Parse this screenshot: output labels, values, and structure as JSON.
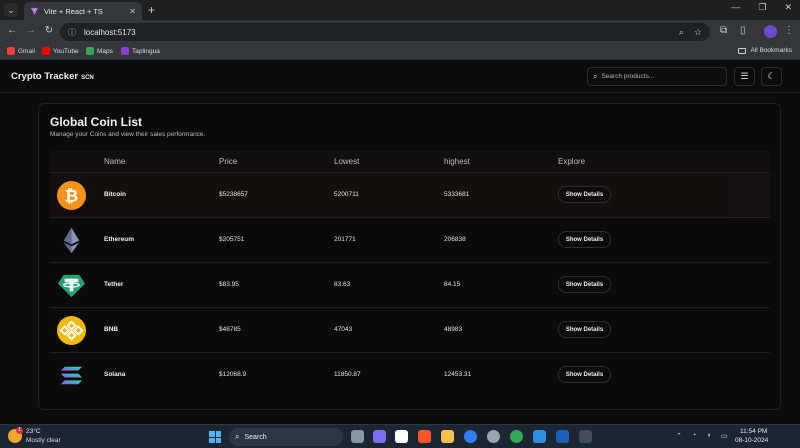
{
  "browser": {
    "tab_title": "Vite + React + TS",
    "url": "localhost:5173",
    "bookmarks": [
      {
        "label": "Gmail",
        "color": "#ea4335"
      },
      {
        "label": "YouTube",
        "color": "#ff0000"
      },
      {
        "label": "Maps",
        "color": "#34a853"
      },
      {
        "label": "Taplingua",
        "color": "#8b3dd6"
      }
    ],
    "all_bookmarks": "All Bookmarks"
  },
  "app": {
    "brand": "Crypto Tracker",
    "brand_suffix": "SCN",
    "search_placeholder": "Search products...",
    "title": "Global Coin List",
    "subtitle": "Manage your Coins and view their sales performance.",
    "columns": [
      "Name",
      "Price",
      "Lowest",
      "highest",
      "Explore"
    ],
    "button_label": "Show Details",
    "coins": [
      {
        "name": "Bitcoin",
        "price": "$5238657",
        "lowest": "5200711",
        "highest": "5333681",
        "icon": "bitcoin-icon"
      },
      {
        "name": "Ethereum",
        "price": "$205751",
        "lowest": "201771",
        "highest": "206838",
        "icon": "ethereum-icon"
      },
      {
        "name": "Tether",
        "price": "$83.95",
        "lowest": "83.63",
        "highest": "84.15",
        "icon": "tether-icon"
      },
      {
        "name": "BNB",
        "price": "$48785",
        "lowest": "47043",
        "highest": "48983",
        "icon": "bnb-icon"
      },
      {
        "name": "Solana",
        "price": "$12068.9",
        "lowest": "11850.87",
        "highest": "12453.31",
        "icon": "solana-icon"
      }
    ]
  },
  "taskbar": {
    "temperature": "23°C",
    "weather": "Mostly clear",
    "weather_badge": "1",
    "search_label": "Search",
    "time": "11:54 PM",
    "date": "08-10-2024"
  },
  "colors": {
    "bitcoin": "#f7931a",
    "tether": "#26a17b",
    "bnb": "#f0b90b"
  }
}
